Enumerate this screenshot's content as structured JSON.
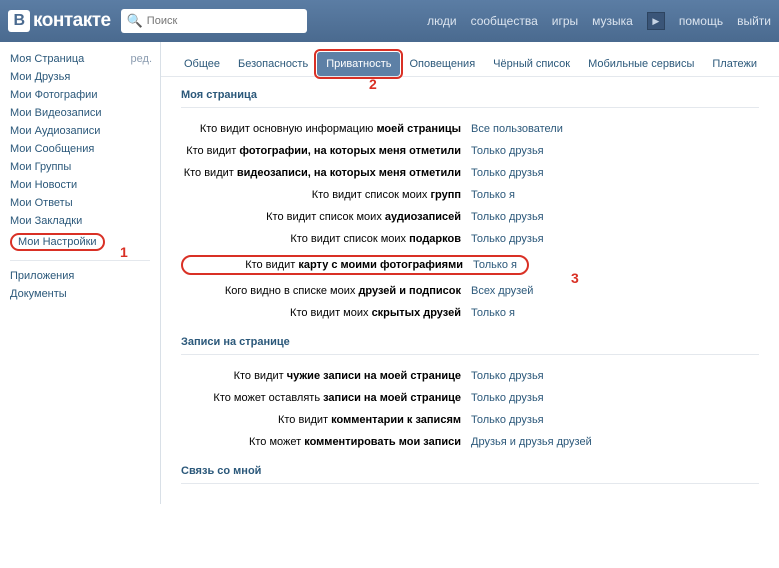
{
  "header": {
    "logo_text": "контакте",
    "logo_letter": "В",
    "search_placeholder": "Поиск",
    "nav": {
      "people": "люди",
      "communities": "сообщества",
      "games": "игры",
      "music": "музыка",
      "help": "помощь",
      "logout": "выйти"
    }
  },
  "sidebar": {
    "my_page": "Моя Страница",
    "edit": "ред.",
    "friends": "Мои Друзья",
    "photos": "Мои Фотографии",
    "videos": "Мои Видеозаписи",
    "audio": "Мои Аудиозаписи",
    "messages": "Мои Сообщения",
    "groups": "Мои Группы",
    "news": "Мои Новости",
    "answers": "Мои Ответы",
    "bookmarks": "Мои Закладки",
    "settings": "Мои Настройки",
    "apps": "Приложения",
    "docs": "Документы"
  },
  "tabs": {
    "general": "Общее",
    "security": "Безопасность",
    "privacy": "Приватность",
    "notifications": "Оповещения",
    "blacklist": "Чёрный список",
    "mobile": "Мобильные сервисы",
    "payments": "Платежи"
  },
  "annotations": {
    "a1": "1",
    "a2": "2",
    "a3": "3"
  },
  "sections": {
    "my_page": {
      "title": "Моя страница",
      "rows": {
        "r1_pre": "Кто видит основную информацию ",
        "r1_b": "моей страницы",
        "r1_v": "Все пользователи",
        "r2_pre": "Кто видит ",
        "r2_b": "фотографии, на которых меня отметили",
        "r2_v": "Только друзья",
        "r3_pre": "Кто видит ",
        "r3_b": "видеозаписи, на которых меня отметили",
        "r3_v": "Только друзья",
        "r4_pre": "Кто видит список моих ",
        "r4_b": "групп",
        "r4_v": "Только я",
        "r5_pre": "Кто видит список моих ",
        "r5_b": "аудиозаписей",
        "r5_v": "Только друзья",
        "r6_pre": "Кто видит список моих ",
        "r6_b": "подарков",
        "r6_v": "Только друзья",
        "r7_pre": "Кто видит ",
        "r7_b": "карту с моими фотографиями",
        "r7_v": "Только я",
        "r8_pre": "Кого видно в списке моих ",
        "r8_b": "друзей и подписок",
        "r8_v": "Всех друзей",
        "r9_pre": "Кто видит моих ",
        "r9_b": "скрытых друзей",
        "r9_v": "Только я"
      }
    },
    "wall": {
      "title": "Записи на странице",
      "rows": {
        "r1_pre": "Кто видит ",
        "r1_b": "чужие записи на моей странице",
        "r1_v": "Только друзья",
        "r2_pre": "Кто может оставлять ",
        "r2_b": "записи на моей странице",
        "r2_v": "Только друзья",
        "r3_pre": "Кто видит ",
        "r3_b": "комментарии к записям",
        "r3_v": "Только друзья",
        "r4_pre": "Кто может ",
        "r4_b": "комментировать мои записи",
        "r4_v": "Друзья и друзья друзей"
      }
    },
    "contact": {
      "title": "Связь со мной"
    }
  }
}
